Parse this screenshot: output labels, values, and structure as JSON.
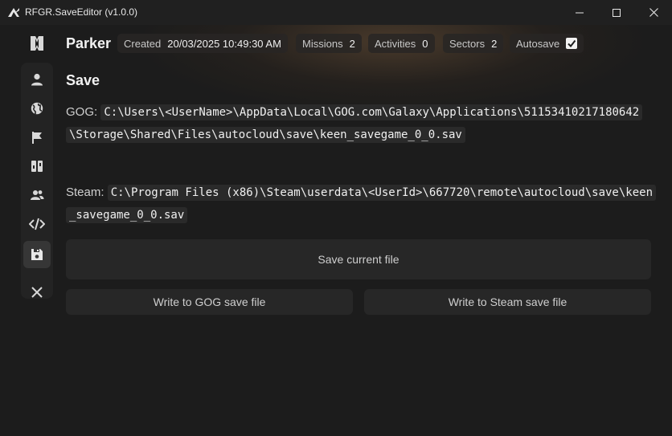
{
  "window": {
    "title": "RFGR.SaveEditor (v1.0.0)",
    "icons": {
      "app": "rfgr-app-icon",
      "minimize": "minimize-icon",
      "maximize": "maximize-icon",
      "close": "close-icon"
    }
  },
  "sidebar": {
    "items": [
      {
        "name": "sidebar-item-logo",
        "icon": "book-icon"
      },
      {
        "name": "sidebar-item-player",
        "icon": "person-icon"
      },
      {
        "name": "sidebar-item-world",
        "icon": "globe-icon"
      },
      {
        "name": "sidebar-item-missions",
        "icon": "flag-icon"
      },
      {
        "name": "sidebar-item-activities",
        "icon": "columns-icon"
      },
      {
        "name": "sidebar-item-people",
        "icon": "people-icon"
      },
      {
        "name": "sidebar-item-code",
        "icon": "code-icon"
      },
      {
        "name": "sidebar-item-save",
        "icon": "floppy-disk-icon",
        "active": true
      },
      {
        "name": "sidebar-item-close",
        "icon": "close-x-icon"
      }
    ]
  },
  "header": {
    "player_name": "Parker",
    "created_label": "Created",
    "created_value": "20/03/2025 10:49:30 AM",
    "missions_label": "Missions",
    "missions_value": "2",
    "activities_label": "Activities",
    "activities_value": "0",
    "sectors_label": "Sectors",
    "sectors_value": "2",
    "autosave_label": "Autosave",
    "autosave_checked": true
  },
  "save": {
    "title": "Save",
    "gog_label": "GOG:",
    "gog_path": "C:\\Users\\<UserName>\\AppData\\Local\\GOG.com\\Galaxy\\Applications\\51153410217180642\\Storage\\Shared\\Files\\autocloud\\save\\keen_savegame_0_0.sav",
    "steam_label": "Steam:",
    "steam_path": "C:\\Program Files (x86)\\Steam\\userdata\\<UserId>\\667720\\remote\\autocloud\\save\\keen_savegame_0_0.sav",
    "save_current_label": "Save current file",
    "write_gog_label": "Write to GOG save file",
    "write_steam_label": "Write to Steam save file"
  },
  "colors": {
    "background": "#1c1c1c",
    "titlebar": "#202020",
    "button": "#272727",
    "active_nav": "#363636"
  }
}
